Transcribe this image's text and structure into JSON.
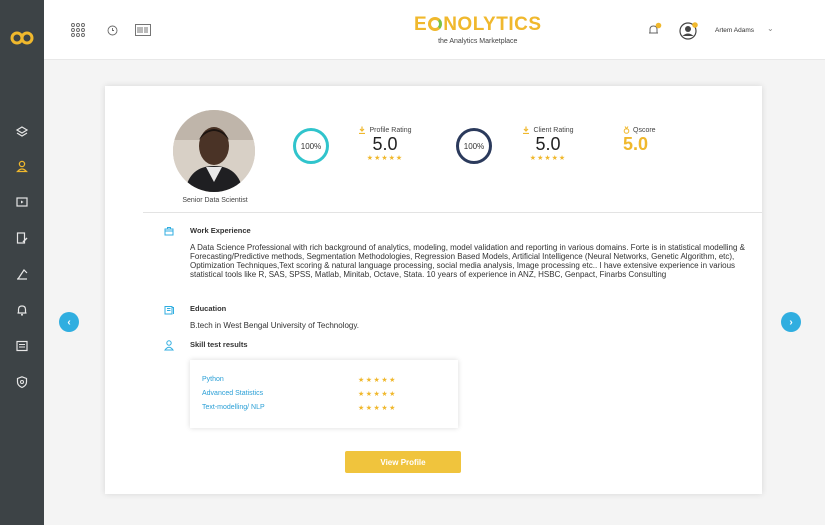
{
  "app": {
    "brand_name_pre": "E",
    "brand_name_post": "NOLYTICS",
    "brand_tagline": "the Analytics Marketplace",
    "accent_color": "#f0b82d",
    "sidebar_color": "#3d4346"
  },
  "sidebar": {
    "items": [
      {
        "icon": "layers-icon"
      },
      {
        "icon": "user-icon",
        "active": true
      },
      {
        "icon": "media-icon"
      },
      {
        "icon": "edit-document-icon"
      },
      {
        "icon": "scale-icon"
      },
      {
        "icon": "bell-icon"
      },
      {
        "icon": "list-icon"
      },
      {
        "icon": "shield-icon"
      }
    ]
  },
  "header": {
    "left_icons": [
      "apps-grid-icon",
      "clock-icon",
      "barcode-icon"
    ],
    "right_icons": [
      "notification-bell-icon",
      "user-avatar-icon"
    ],
    "user_name": "Artem Adams"
  },
  "profile": {
    "role": "Senior Data Scientist",
    "profile_completion": "100%",
    "profile_rating_label": "Profile Rating",
    "profile_rating_value": "5.0",
    "profile_stars": "★★★★★",
    "client_completion": "100%",
    "client_rating_label": "Client Rating",
    "client_rating_value": "5.0",
    "client_stars": "★★★★★",
    "qscore_label": "Qscore",
    "qscore_value": "5.0"
  },
  "work": {
    "title": "Work Experience",
    "text": "A Data Science Professional with rich background of analytics, modeling, model validation and reporting in various domains. Forte is in statistical modelling & Forecasting/Predictive methods, Segmentation Methodologies, Regression Based Models, Artificial Intelligence (Neural Networks, Genetic Algorithm, etc), Optimization Techniques,Text scoring & natural language processing, social media analysis, Image processing etc.. I have extensive experience in various statistical tools like R, SAS, SPSS, Matlab, Minitab, Octave, Stata. 10 years of experience in ANZ, HSBC, Genpact, Finarbs Consulting"
  },
  "education": {
    "title": "Education",
    "text": "B.tech in West Bengal University of Technology."
  },
  "skills": {
    "title": "Skill test results",
    "items": [
      {
        "name": "Python",
        "stars": "★★★★★"
      },
      {
        "name": "Advanced Statistics",
        "stars": "★★★★★"
      },
      {
        "name": "Text-modelling/ NLP",
        "stars": "★★★★★"
      }
    ]
  },
  "actions": {
    "view_profile": "View Profile"
  }
}
